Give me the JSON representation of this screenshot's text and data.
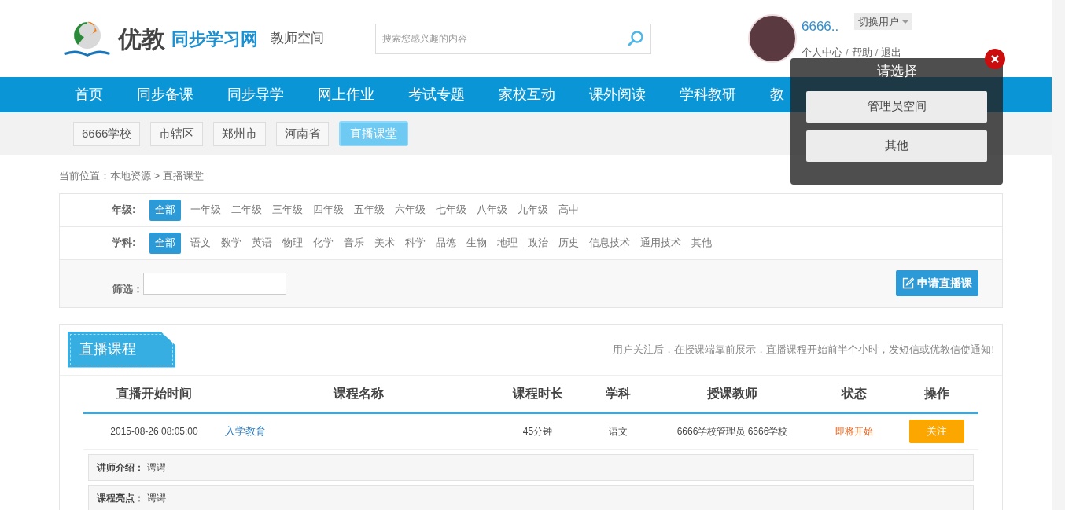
{
  "header": {
    "logo": {
      "brand": "优教",
      "product": "同步学习网"
    },
    "space_name": "教师空间",
    "search": {
      "placeholder": "搜索您感兴趣的内容"
    },
    "user": {
      "name": "6666..",
      "switch_label": "切换用户",
      "links": [
        "个人中心",
        "帮助",
        "退出"
      ],
      "separator": "/"
    }
  },
  "nav": [
    {
      "label": "首页"
    },
    {
      "label": "同步备课"
    },
    {
      "label": "同步导学"
    },
    {
      "label": "网上作业"
    },
    {
      "label": "考试专题"
    },
    {
      "label": "家校互动"
    },
    {
      "label": "课外阅读"
    },
    {
      "label": "学科教研"
    },
    {
      "label": "教"
    }
  ],
  "scope_tabs": [
    {
      "label": "6666学校",
      "selected": false
    },
    {
      "label": "市辖区",
      "selected": false
    },
    {
      "label": "郑州市",
      "selected": false
    },
    {
      "label": "河南省",
      "selected": false
    },
    {
      "label": "直播课堂",
      "selected": true
    }
  ],
  "breadcrumb": "当前位置：本地资源 > 直播课堂",
  "filters": [
    {
      "label": "年级:",
      "options": [
        {
          "label": "全部",
          "selected": true
        },
        {
          "label": "一年级",
          "selected": false
        },
        {
          "label": "二年级",
          "selected": false
        },
        {
          "label": "三年级",
          "selected": false
        },
        {
          "label": "四年级",
          "selected": false
        },
        {
          "label": "五年级",
          "selected": false
        },
        {
          "label": "六年级",
          "selected": false
        },
        {
          "label": "七年级",
          "selected": false
        },
        {
          "label": "八年级",
          "selected": false
        },
        {
          "label": "九年级",
          "selected": false
        },
        {
          "label": "高中",
          "selected": false
        }
      ]
    },
    {
      "label": "学科:",
      "options": [
        {
          "label": "全部",
          "selected": true
        },
        {
          "label": "语文",
          "selected": false
        },
        {
          "label": "数学",
          "selected": false
        },
        {
          "label": "英语",
          "selected": false
        },
        {
          "label": "物理",
          "selected": false
        },
        {
          "label": "化学",
          "selected": false
        },
        {
          "label": "音乐",
          "selected": false
        },
        {
          "label": "美术",
          "selected": false
        },
        {
          "label": "科学",
          "selected": false
        },
        {
          "label": "品德",
          "selected": false
        },
        {
          "label": "生物",
          "selected": false
        },
        {
          "label": "地理",
          "selected": false
        },
        {
          "label": "政治",
          "selected": false
        },
        {
          "label": "历史",
          "selected": false
        },
        {
          "label": "信息技术",
          "selected": false
        },
        {
          "label": "通用技术",
          "selected": false
        },
        {
          "label": "其他",
          "selected": false
        }
      ]
    }
  ],
  "screen": {
    "label": "筛选：",
    "apply_button": "申请直播课"
  },
  "courses": {
    "title": "直播课程",
    "notice": "用户关注后，在授课端靠前展示，直播课程开始前半个小时，发短信或优教信使通知!",
    "columns": [
      "直播开始时间",
      "课程名称",
      "课程时长",
      "学科",
      "授课教师",
      "状态",
      "操作"
    ],
    "rows": [
      {
        "start": "2015-08-26 08:05:00",
        "name": "入学教育",
        "duration": "45分钟",
        "subject": "语文",
        "teacher": "6666学校管理员 6666学校",
        "status": "即将开始",
        "action": "关注"
      }
    ],
    "details": [
      {
        "label": "讲师介绍：",
        "value": "谔谔"
      },
      {
        "label": "课程亮点：",
        "value": "谔谔"
      }
    ]
  },
  "switch_popup": {
    "title": "请选择",
    "options": [
      "管理员空间",
      "其他"
    ]
  }
}
